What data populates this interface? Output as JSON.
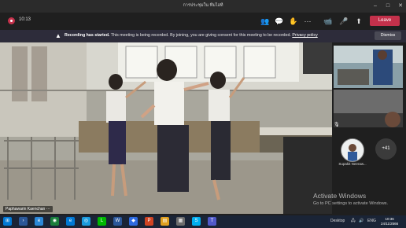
{
  "window": {
    "title": "การประชุมใน ทีมไอที"
  },
  "toolbar": {
    "timer": "10:13",
    "leave_label": "Leave"
  },
  "banner": {
    "heading": "Recording has started.",
    "message": "This meeting is being recorded. By joining, you are giving consent for this meeting to be recorded.",
    "link": "Privacy policy",
    "dismiss_label": "Dismiss"
  },
  "stage": {
    "participant_name": "Paphawarin Kaenchan",
    "more_label": "···"
  },
  "side": {
    "avatar_name": "Supakit Neeraw...",
    "more_count": "+41"
  },
  "watermark": {
    "line1": "Activate Windows",
    "line2": "Go to PC settings to activate Windows."
  },
  "taskbar": {
    "time": "10:36",
    "date": "24/11/2566",
    "lang": "ENG"
  },
  "colors": {
    "leave": "#c4314b",
    "banner": "#2d2c3a",
    "taskbar": "#1a2436"
  }
}
